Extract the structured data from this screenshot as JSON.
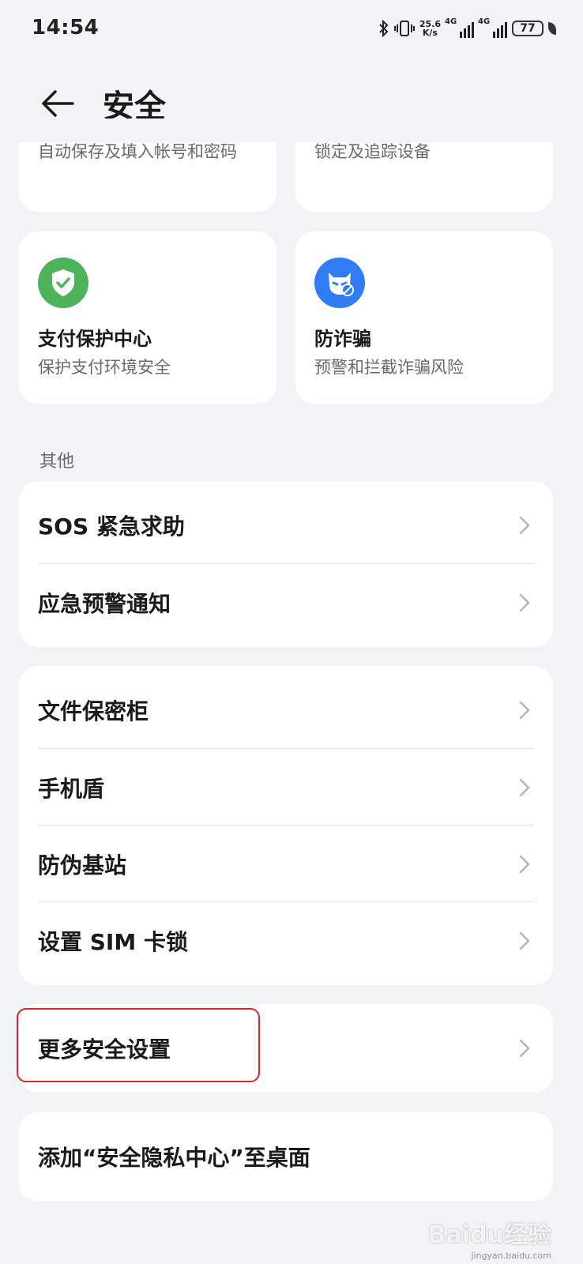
{
  "status_bar": {
    "time": "14:54",
    "net_speed_value": "25.6",
    "net_speed_unit": "K/s",
    "signal1_label": "4G",
    "signal2_label": "4G",
    "battery": "77"
  },
  "header": {
    "title": "安全"
  },
  "top_cards": {
    "left_sub": "自动保存及填入帐号和密码",
    "right_sub": "锁定及追踪设备"
  },
  "tiles": [
    {
      "title": "支付保护中心",
      "subtitle": "保护支付环境安全",
      "icon": "shield-check-icon",
      "color": "#4cb35a"
    },
    {
      "title": "防诈骗",
      "subtitle": "预警和拦截诈骗风险",
      "icon": "anti-fraud-icon",
      "color": "#2f7cf6"
    }
  ],
  "section_other": "其他",
  "group1": [
    {
      "label": "SOS 紧急求助"
    },
    {
      "label": "应急预警通知"
    }
  ],
  "group2": [
    {
      "label": "文件保密柜"
    },
    {
      "label": "手机盾"
    },
    {
      "label": "防伪基站"
    },
    {
      "label": "设置 SIM 卡锁"
    }
  ],
  "more_settings": {
    "label": "更多安全设置"
  },
  "add_to_desktop": {
    "label": "添加“安全隐私中心”至桌面"
  },
  "watermark": {
    "text": "Baidu经验",
    "sub": "jingyan.baidu.com"
  },
  "colors": {
    "highlight": "#d9262c",
    "background": "#f1f3f5"
  }
}
